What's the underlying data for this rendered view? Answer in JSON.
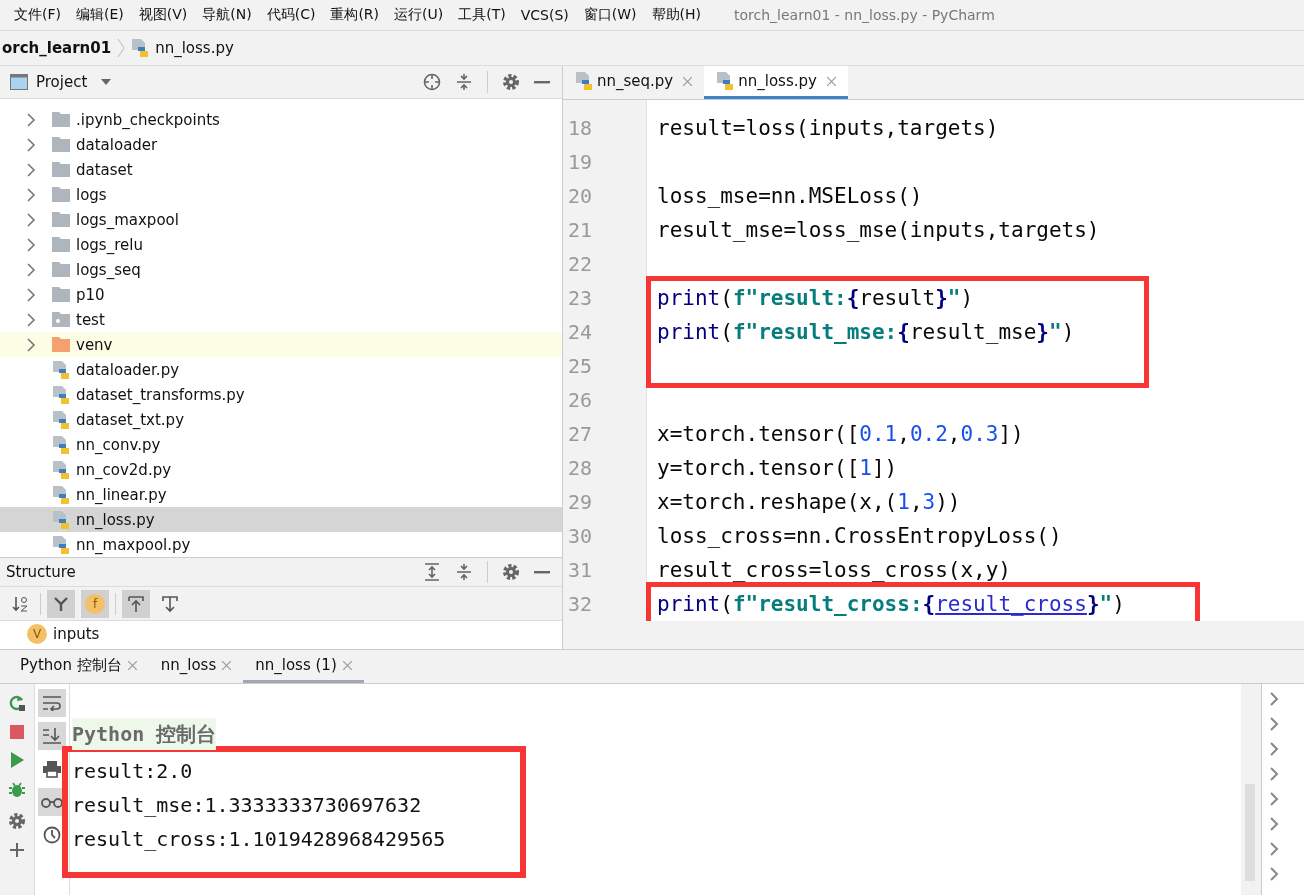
{
  "menu": [
    "文件(F)",
    "编辑(E)",
    "视图(V)",
    "导航(N)",
    "代码(C)",
    "重构(R)",
    "运行(U)",
    "工具(T)",
    "VCS(S)",
    "窗口(W)",
    "帮助(H)"
  ],
  "window": {
    "title": "torch_learn01 - nn_loss.py - PyCharm"
  },
  "breadcrumb": [
    {
      "label": "orch_learn01",
      "kind": "project"
    },
    {
      "label": "nn_loss.py",
      "kind": "python"
    }
  ],
  "project_panel": {
    "title": "Project",
    "tree": [
      {
        "label": ".ipynb_checkpoints",
        "kind": "folder",
        "selected": false
      },
      {
        "label": "dataloader",
        "kind": "folder",
        "selected": false
      },
      {
        "label": "dataset",
        "kind": "folder",
        "selected": false
      },
      {
        "label": "logs",
        "kind": "folder",
        "selected": false
      },
      {
        "label": "logs_maxpool",
        "kind": "folder",
        "selected": false
      },
      {
        "label": "logs_relu",
        "kind": "folder",
        "selected": false
      },
      {
        "label": "logs_seq",
        "kind": "folder",
        "selected": false
      },
      {
        "label": "p10",
        "kind": "folder",
        "selected": false
      },
      {
        "label": "test",
        "kind": "test_folder",
        "selected": false
      },
      {
        "label": "venv",
        "kind": "excluded_folder",
        "selected": false
      },
      {
        "label": "dataloader.py",
        "kind": "python",
        "selected": false
      },
      {
        "label": "dataset_transforms.py",
        "kind": "python",
        "selected": false
      },
      {
        "label": "dataset_txt.py",
        "kind": "python",
        "selected": false
      },
      {
        "label": "nn_conv.py",
        "kind": "python",
        "selected": false
      },
      {
        "label": "nn_cov2d.py",
        "kind": "python",
        "selected": false
      },
      {
        "label": "nn_linear.py",
        "kind": "python",
        "selected": false
      },
      {
        "label": "nn_loss.py",
        "kind": "python",
        "selected": true
      },
      {
        "label": "nn_maxpool.py",
        "kind": "python",
        "selected": false
      }
    ]
  },
  "structure_panel": {
    "title": "Structure",
    "tools": [
      {
        "kind": "sort",
        "pressed": false
      },
      {
        "kind": "fields",
        "pressed": true
      },
      {
        "kind": "function",
        "letter": "f",
        "pressed": true
      },
      {
        "kind": "autoscroll_from",
        "pressed": true
      },
      {
        "kind": "autoscroll_to",
        "pressed": false
      }
    ],
    "items": [
      {
        "label": "inputs",
        "letter": "V"
      }
    ]
  },
  "editor": {
    "tabs": [
      {
        "label": "nn_seq.py",
        "selected": false
      },
      {
        "label": "nn_loss.py",
        "selected": true
      }
    ],
    "blocks": [
      {
        "marked": false,
        "lines": [
          {
            "number": "18",
            "tokens": [
              {
                "kind": "plain",
                "text": "result=loss(inputs,targets)"
              }
            ]
          },
          {
            "number": "19"
          },
          {
            "number": "20",
            "tokens": [
              {
                "kind": "plain",
                "text": "loss_mse=nn.MSELoss()"
              }
            ]
          },
          {
            "number": "21",
            "tokens": [
              {
                "kind": "plain",
                "text": "result_mse=loss_mse(inputs,targets)"
              }
            ]
          },
          {
            "number": "22"
          }
        ]
      },
      {
        "marked": true,
        "lines": [
          {
            "number": "23",
            "tokens": [
              {
                "kind": "builtin",
                "text": "print"
              },
              {
                "kind": "plain",
                "text": "("
              },
              {
                "kind": "string",
                "text": "f\"result:"
              },
              {
                "kind": "brace",
                "text": "{"
              },
              {
                "kind": "plain",
                "text": "result"
              },
              {
                "kind": "brace",
                "text": "}"
              },
              {
                "kind": "string",
                "text": "\""
              },
              {
                "kind": "plain",
                "text": ")"
              }
            ]
          },
          {
            "number": "24",
            "tokens": [
              {
                "kind": "builtin",
                "text": "print"
              },
              {
                "kind": "plain",
                "text": "("
              },
              {
                "kind": "string",
                "text": "f\"result_mse:"
              },
              {
                "kind": "brace",
                "text": "{"
              },
              {
                "kind": "plain",
                "text": "result_mse"
              },
              {
                "kind": "brace",
                "text": "}"
              },
              {
                "kind": "string",
                "text": "\""
              },
              {
                "kind": "plain",
                "text": ")"
              }
            ]
          },
          {
            "number": "25"
          }
        ]
      },
      {
        "marked": false,
        "lines": [
          {
            "number": "26"
          },
          {
            "number": "27",
            "tokens": [
              {
                "kind": "plain",
                "text": "x=torch.tensor(["
              },
              {
                "kind": "number",
                "text": "0.1"
              },
              {
                "kind": "plain",
                "text": ","
              },
              {
                "kind": "number",
                "text": "0.2"
              },
              {
                "kind": "plain",
                "text": ","
              },
              {
                "kind": "number",
                "text": "0.3"
              },
              {
                "kind": "plain",
                "text": "])"
              }
            ]
          },
          {
            "number": "28",
            "tokens": [
              {
                "kind": "plain",
                "text": "y=torch.tensor(["
              },
              {
                "kind": "number",
                "text": "1"
              },
              {
                "kind": "plain",
                "text": "])"
              }
            ]
          },
          {
            "number": "29",
            "tokens": [
              {
                "kind": "plain",
                "text": "x=torch.reshape(x,("
              },
              {
                "kind": "number",
                "text": "1"
              },
              {
                "kind": "plain",
                "text": ","
              },
              {
                "kind": "number",
                "text": "3"
              },
              {
                "kind": "plain",
                "text": "))"
              }
            ]
          },
          {
            "number": "30",
            "tokens": [
              {
                "kind": "plain",
                "text": "loss_cross=nn.CrossEntropyLoss()"
              }
            ]
          },
          {
            "number": "31",
            "tokens": [
              {
                "kind": "plain",
                "text": "result_cross=loss_cross(x,y)"
              }
            ]
          }
        ]
      },
      {
        "marked": true,
        "lines": [
          {
            "number": "32",
            "tokens": [
              {
                "kind": "builtin",
                "text": "print"
              },
              {
                "kind": "plain",
                "text": "("
              },
              {
                "kind": "string",
                "text": "f\"result_cross:"
              },
              {
                "kind": "brace",
                "text": "{"
              },
              {
                "kind": "link",
                "text": "result_cross"
              },
              {
                "kind": "brace",
                "text": "}"
              },
              {
                "kind": "string",
                "text": "\""
              },
              {
                "kind": "plain",
                "text": ")"
              }
            ]
          }
        ]
      }
    ]
  },
  "run_panel": {
    "tabs": [
      {
        "label": "Python 控制台",
        "selected": false
      },
      {
        "label": "nn_loss",
        "selected": false
      },
      {
        "label": "nn_loss (1)",
        "selected": true
      }
    ],
    "actions": [
      {
        "kind": "rerun"
      },
      {
        "kind": "stop"
      },
      {
        "kind": "run"
      },
      {
        "kind": "debug"
      },
      {
        "kind": "settings"
      },
      {
        "kind": "add"
      }
    ],
    "tools": [
      {
        "kind": "wrap",
        "pressed": true
      },
      {
        "kind": "scroll_end",
        "pressed": true
      },
      {
        "kind": "print",
        "pressed": false
      },
      {
        "kind": "glasses",
        "pressed": true
      },
      {
        "kind": "history",
        "pressed": false
      }
    ],
    "console_header": "Python 控制台",
    "output": {
      "marked": true,
      "lines": [
        "result:2.0",
        "result_mse:1.3333333730697632",
        "result_cross:1.1019428968429565"
      ]
    }
  }
}
